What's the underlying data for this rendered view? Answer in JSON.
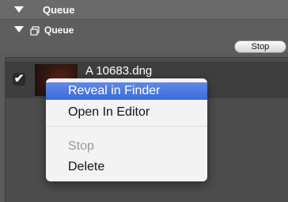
{
  "header": {
    "title": "Queue",
    "group_title": "Queue",
    "stop_label": "Stop"
  },
  "queue_item": {
    "filename": "A 10683.dng",
    "checked_glyph": "✔"
  },
  "context_menu": {
    "items": [
      {
        "label": "Reveal in Finder",
        "state": "selected"
      },
      {
        "label": "Open In Editor",
        "state": "enabled"
      },
      {
        "label": "Stop",
        "state": "disabled"
      },
      {
        "label": "Delete",
        "state": "enabled"
      }
    ]
  },
  "colors": {
    "accent": "#3d6ad9"
  }
}
